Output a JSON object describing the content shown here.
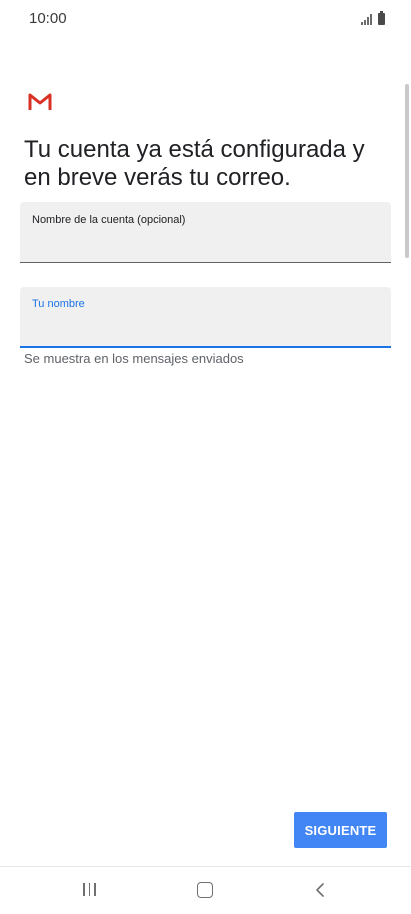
{
  "status_bar": {
    "time": "10:00",
    "icons": [
      "signal-icon",
      "battery-icon"
    ]
  },
  "app": {
    "logo": "gmail-logo-icon",
    "colors": {
      "logo_red": "#d93025",
      "accent": "#1a73e8",
      "button": "#4285f4"
    }
  },
  "heading": "Tu cuenta ya está configurada y en breve verás tu correo.",
  "fields": {
    "account_name": {
      "label": "Nombre de la cuenta (opcional)",
      "value": ""
    },
    "your_name": {
      "label": "Tu nombre",
      "value": "",
      "helper": "Se muestra en los mensajes enviados"
    }
  },
  "buttons": {
    "next": "SIGUIENTE"
  },
  "nav_bar": {
    "icons": [
      "recents-icon",
      "home-icon",
      "back-icon"
    ]
  }
}
